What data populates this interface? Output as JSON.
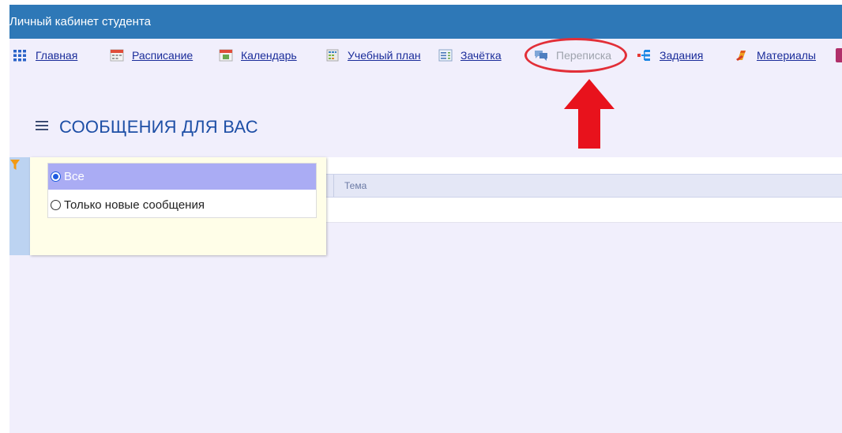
{
  "app": {
    "title": "Личный кабинет студента"
  },
  "nav": {
    "items": [
      {
        "label": "Главная",
        "icon": "grid-icon"
      },
      {
        "label": "Расписание",
        "icon": "schedule-icon"
      },
      {
        "label": "Календарь",
        "icon": "calendar-icon"
      },
      {
        "label": "Учебный план",
        "icon": "study-plan-icon"
      },
      {
        "label": "Зачётка",
        "icon": "record-book-icon"
      },
      {
        "label": "Переписка",
        "icon": "chat-bubbles-icon",
        "active": true
      },
      {
        "label": "Задания",
        "icon": "tasks-icon"
      },
      {
        "label": "Материалы",
        "icon": "materials-icon"
      }
    ]
  },
  "page": {
    "title": "СООБЩЕНИЯ ДЛЯ ВАС",
    "menu_icon": "hamburger-icon"
  },
  "table": {
    "columns": [
      "Тема"
    ]
  },
  "filter": {
    "icon": "funnel-icon",
    "options": [
      {
        "label": "Все",
        "selected": true
      },
      {
        "label": "Только новые сообщения",
        "selected": false
      }
    ]
  },
  "annotation": {
    "type": "red-arrow-and-ellipse",
    "target": "Переписка",
    "color": "#e22f38"
  },
  "colors": {
    "header": "#2e78b7",
    "link": "#1a2c9a",
    "page_bg": "#f1effc",
    "selected_option": "#aaacf4"
  }
}
